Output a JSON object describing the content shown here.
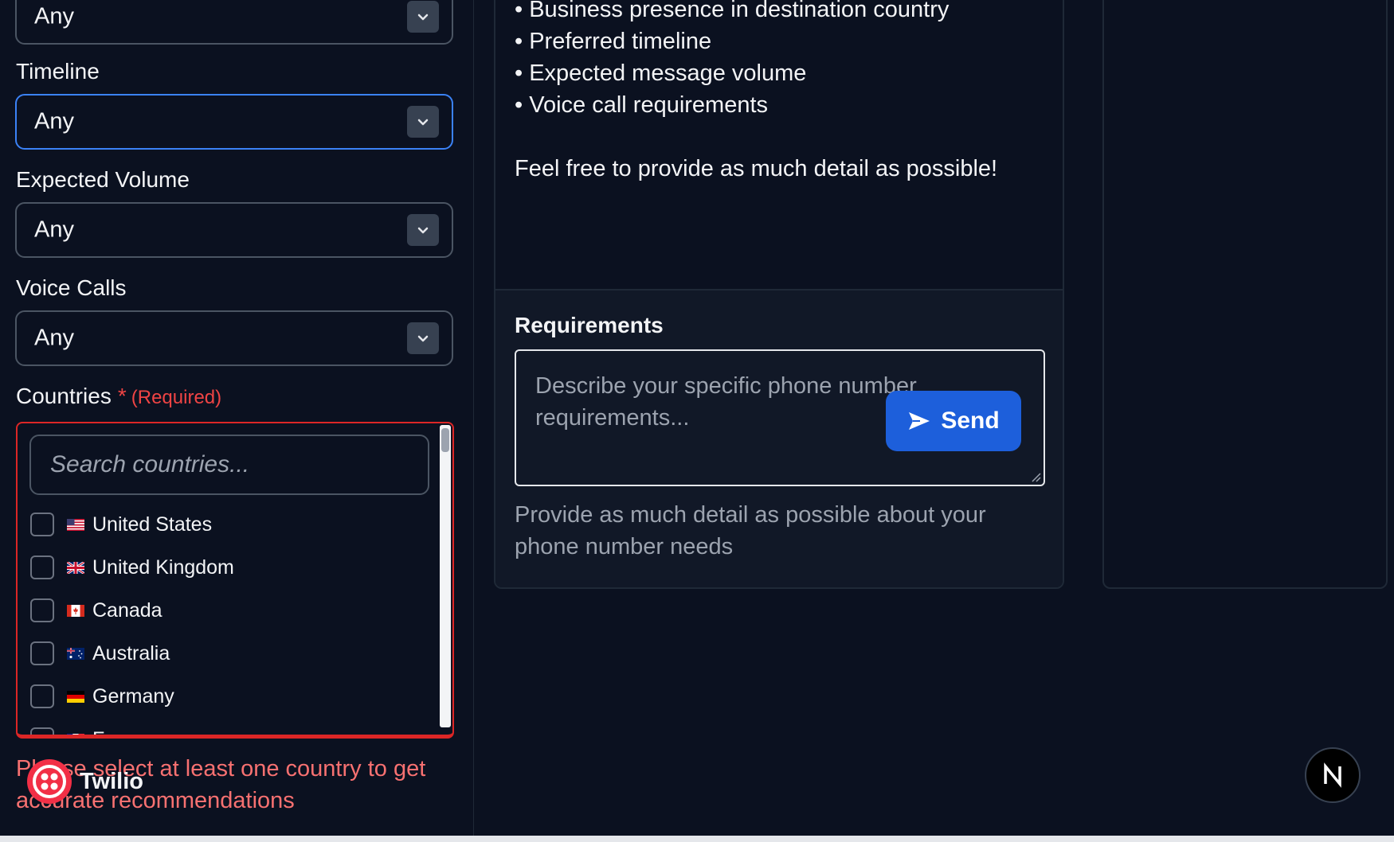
{
  "filters": {
    "top_select_value": "Any",
    "timeline": {
      "label": "Timeline",
      "value": "Any"
    },
    "expected_volume": {
      "label": "Expected Volume",
      "value": "Any"
    },
    "voice_calls": {
      "label": "Voice Calls",
      "value": "Any"
    }
  },
  "countries": {
    "label": "Countries",
    "required_star": "*",
    "required_text": "(Required)",
    "search_placeholder": "Search countries...",
    "items": [
      {
        "name": "United States",
        "flag": "us-flag-icon"
      },
      {
        "name": "United Kingdom",
        "flag": "uk-flag-icon"
      },
      {
        "name": "Canada",
        "flag": "canada-flag-icon"
      },
      {
        "name": "Australia",
        "flag": "australia-flag-icon"
      },
      {
        "name": "Germany",
        "flag": "germany-flag-icon"
      },
      {
        "name": "France",
        "flag": "france-flag-icon"
      }
    ],
    "error": "Please select at least one country to get accurate recommendations"
  },
  "brand": {
    "name": "Twilio",
    "icon": "twilio-logo-icon"
  },
  "chat": {
    "bullets": [
      "• Business presence in destination country",
      "• Preferred timeline",
      "• Expected message volume",
      "• Voice call requirements"
    ],
    "footer": "Feel free to provide as much detail as possible!"
  },
  "composer": {
    "label": "Requirements",
    "placeholder": "Describe your specific phone number requirements...",
    "send_label": "Send",
    "helper": "Provide as much detail as possible about your phone number needs"
  },
  "badge": {
    "icon": "nextjs-n-icon"
  },
  "colors": {
    "background": "#0b1120",
    "panel": "#111827",
    "border": "#4b5563",
    "focus": "#3b82f6",
    "error": "#ef4444",
    "primary": "#1d5fdb"
  }
}
